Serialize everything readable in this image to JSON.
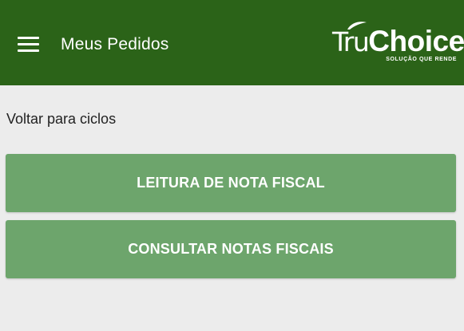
{
  "header": {
    "title": "Meus Pedidos",
    "menu_icon": "hamburger-menu-icon",
    "background_color": "#2b6318",
    "logo": {
      "text_light": "Tru",
      "text_bold": "Choice",
      "tagline": "SOLUÇÃO QUE RENDE"
    }
  },
  "main": {
    "back_link": "Voltar para ciclos",
    "buttons": [
      {
        "label": "LEITURA DE NOTA FISCAL"
      },
      {
        "label": "CONSULTAR NOTAS FISCAIS"
      }
    ],
    "button_color": "#6da56c",
    "background_color": "#ececec"
  }
}
